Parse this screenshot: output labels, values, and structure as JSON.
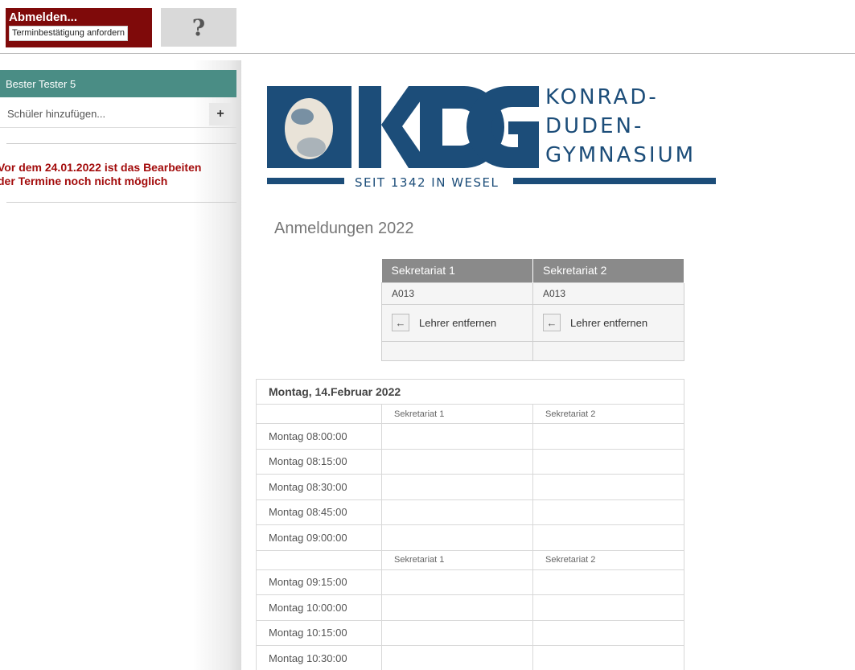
{
  "topbar": {
    "logout_label": "Abmelden...",
    "confirm_label": "Terminbestätigung anfordern",
    "help_label": "?"
  },
  "sidebar": {
    "student_name": "Bester Tester 5",
    "add_student_label": "Schüler hinzufügen...",
    "add_button_label": "+",
    "warning_line1": "Vor dem 24.01.2022 ist das Bearbeiten",
    "warning_line2": "der Termine noch nicht möglich"
  },
  "logo": {
    "line1": "KONRAD-",
    "line2": "DUDEN-",
    "line3": "GYMNASIUM",
    "tagline": "SEIT 1342 IN WESEL",
    "brand_color": "#1c4d79"
  },
  "main": {
    "title": "Anmeldungen 2022"
  },
  "teachers": [
    {
      "name": "Sekretariat 1",
      "room": "A013",
      "remove_label": "Lehrer entfernen"
    },
    {
      "name": "Sekretariat 2",
      "room": "A013",
      "remove_label": "Lehrer entfernen"
    }
  ],
  "schedule": {
    "day": "Montag, 14.Februar 2022",
    "col1": "Sekretariat 1",
    "col2": "Sekretariat 2",
    "slots": [
      "Montag 08:00:00",
      "Montag 08:15:00",
      "Montag 08:30:00",
      "Montag 08:45:00",
      "Montag 09:00:00",
      "Montag 09:15:00",
      "Montag 10:00:00",
      "Montag 10:15:00",
      "Montag 10:30:00"
    ]
  }
}
